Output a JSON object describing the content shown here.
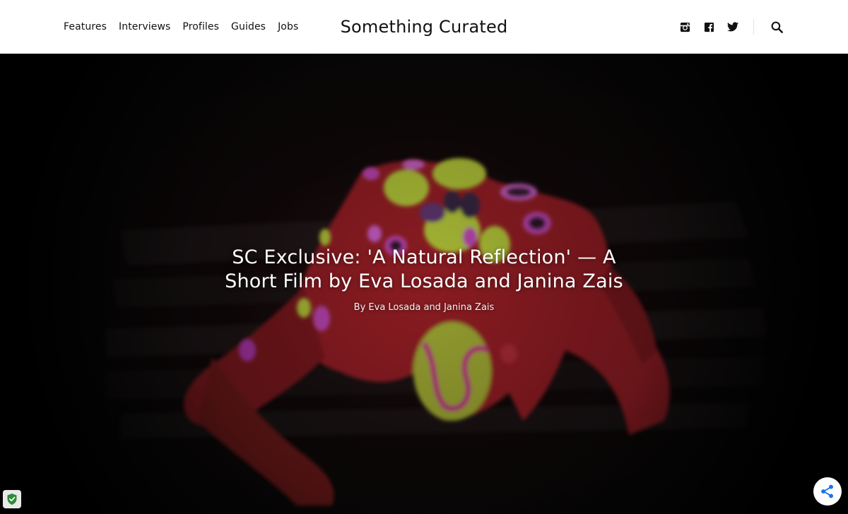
{
  "header": {
    "nav": [
      {
        "label": "Features"
      },
      {
        "label": "Interviews"
      },
      {
        "label": "Profiles"
      },
      {
        "label": "Guides"
      },
      {
        "label": "Jobs"
      }
    ],
    "brand": "Something Curated",
    "social": [
      {
        "icon": "instagram-icon"
      },
      {
        "icon": "facebook-icon"
      },
      {
        "icon": "twitter-icon"
      }
    ],
    "search_icon": "search-icon"
  },
  "hero": {
    "title": "SC Exclusive: 'A Natural Reflection' — A Short Film by Eva Losada and Janina Zais",
    "byline": "By Eva Losada and Janina Zais"
  },
  "widgets": {
    "privacy_icon": "shield-check-icon",
    "share_icon": "share-icon",
    "share_color": "#1a73e8",
    "privacy_color": "#2e8b3a"
  },
  "colors": {
    "header_bg": "#ffffff",
    "text_dark": "#111111",
    "hero_text": "#ffffff"
  }
}
